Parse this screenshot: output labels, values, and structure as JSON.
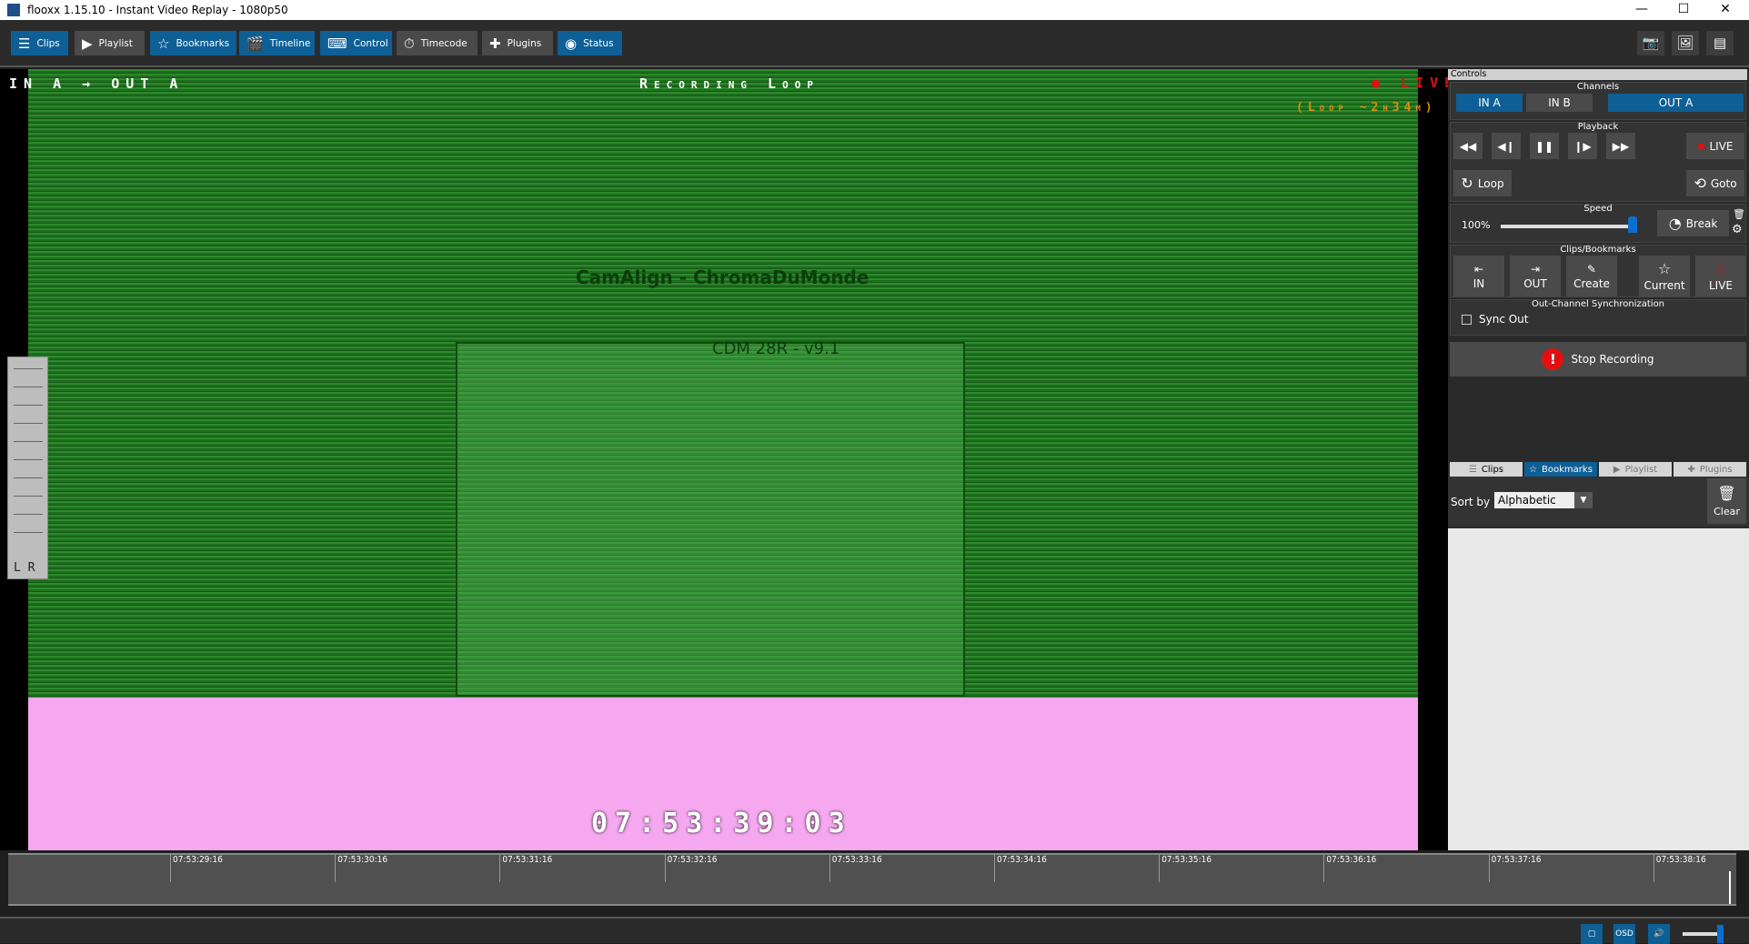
{
  "window": {
    "title": "flooxx 1.15.10 - Instant Video Replay - 1080p50",
    "minimize": "—",
    "maximize": "☐",
    "close": "✕"
  },
  "toolbar": {
    "items": [
      {
        "label": "Clips",
        "icon": "list-icon",
        "active": true
      },
      {
        "label": "Playlist",
        "icon": "play-box-icon",
        "active": false
      },
      {
        "label": "Bookmarks",
        "icon": "star-icon",
        "active": true
      },
      {
        "label": "Timeline",
        "icon": "clapper-icon",
        "active": true
      },
      {
        "label": "Control",
        "icon": "keyboard-icon",
        "active": true
      },
      {
        "label": "Timecode",
        "icon": "stopwatch-icon",
        "active": false
      },
      {
        "label": "Plugins",
        "icon": "puzzle-icon",
        "active": false
      },
      {
        "label": "Status",
        "icon": "status-icon",
        "active": true
      }
    ]
  },
  "video": {
    "routing": "IN A → OUT A",
    "mode": "Recording Loop",
    "live": "LIVE",
    "loop": "(Loop ~2h34m)",
    "timecode": "07:53:39:03",
    "meter_labels": "L R",
    "test_title": "CamAlign - ChromaDuMonde",
    "test_sub": "CDM 28R - v9.1"
  },
  "controls": {
    "header": "Controls",
    "channels": {
      "title": "Channels",
      "items": [
        "IN A",
        "IN B",
        "OUT A"
      ]
    },
    "playback": {
      "title": "Playback",
      "live": "LIVE",
      "loop": "Loop",
      "goto": "Goto"
    },
    "speed": {
      "title": "Speed",
      "value": "100%",
      "level": 1.0,
      "break": "Break"
    },
    "clips": {
      "title": "Clips/Bookmarks",
      "in": "IN",
      "out": "OUT",
      "create": "Create",
      "current": "Current",
      "live": "LIVE"
    },
    "sync": {
      "title": "Out-Channel Synchronization",
      "label": "Sync Out",
      "checked": false
    },
    "stop_recording": "Stop Recording"
  },
  "bottom_tabs": [
    {
      "label": "Clips"
    },
    {
      "label": "Bookmarks",
      "active": true
    },
    {
      "label": "Playlist"
    },
    {
      "label": "Plugins"
    }
  ],
  "sort": {
    "label": "Sort by",
    "value": "Alphabetic",
    "clear": "Clear"
  },
  "timeline": {
    "ticks": [
      "07:53:29:16",
      "07:53:30:16",
      "07:53:31:16",
      "07:53:32:16",
      "07:53:33:16",
      "07:53:34:16",
      "07:53:35:16",
      "07:53:36:16",
      "07:53:37:16",
      "07:53:38:16"
    ]
  },
  "statusbar": {
    "osd": "OSD",
    "volume": 1.0
  },
  "colors": {
    "accent": "#0e5f96",
    "live": "#e01010",
    "loop": "#e08a10",
    "pink": "#f5a8f0"
  }
}
